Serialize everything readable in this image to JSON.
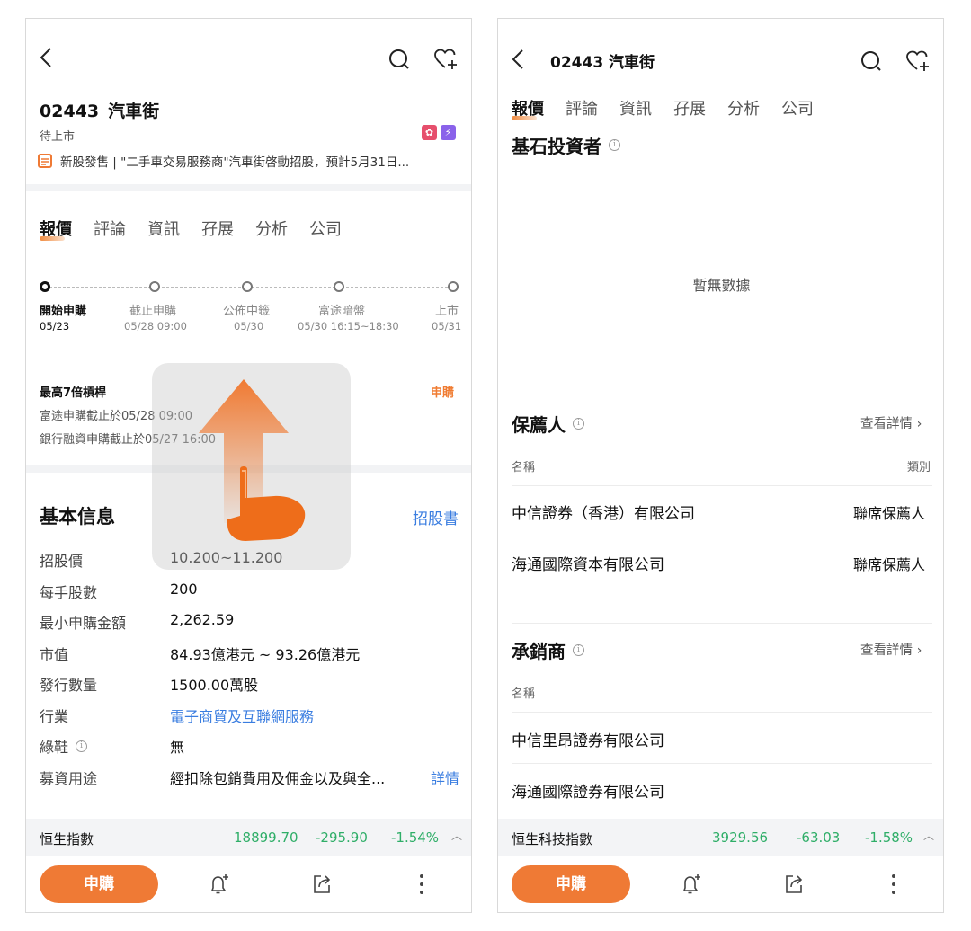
{
  "left": {
    "stock": {
      "code": "02443",
      "name": "汽車街",
      "status": "待上市"
    },
    "news": "新股發售 | \"二手車交易服務商\"汽車街啓動招股，預計5月31日...",
    "tabs": [
      "報價",
      "評論",
      "資訊",
      "孖展",
      "分析",
      "公司"
    ],
    "timeline": [
      {
        "label": "開始申購",
        "date": "05/23"
      },
      {
        "label": "截止申購",
        "date": "05/28 09:00"
      },
      {
        "label": "公佈中籤",
        "date": "05/30"
      },
      {
        "label": "富途暗盤",
        "date": "05/30 16:15~18:30"
      },
      {
        "label": "上市",
        "date": "05/31"
      }
    ],
    "leverage": "最高7倍槓桿",
    "subscribe_cta": "申購",
    "deadline_futu": "富途申購截止於05/28 09:00",
    "deadline_bank": "銀行融資申購截止於05/27 16:00",
    "basic_info": {
      "title": "基本信息",
      "prospectus": "招股書",
      "rows": [
        {
          "label": "招股價",
          "value": "10.200~11.200"
        },
        {
          "label": "每手股數",
          "value": "200"
        },
        {
          "label": "最小申購金額",
          "value": "2,262.59"
        },
        {
          "label": "市值",
          "value": "84.93億港元 ~ 93.26億港元"
        },
        {
          "label": "發行數量",
          "value": "1500.00萬股"
        },
        {
          "label": "行業",
          "value": "電子商貿及互聯網服務"
        },
        {
          "label": "綠鞋",
          "value": "無"
        },
        {
          "label": "募資用途",
          "value": "經扣除包銷費用及佣金以及與全..."
        }
      ],
      "detail_link": "詳情"
    },
    "index": {
      "name": "恒生指數",
      "value": "18899.70",
      "change": "-295.90",
      "pct": "-1.54%"
    },
    "subscribe_button": "申購"
  },
  "right": {
    "header_title": "02443 汽車街",
    "tabs": [
      "報價",
      "評論",
      "資訊",
      "孖展",
      "分析",
      "公司"
    ],
    "cornerstone": {
      "title": "基石投資者",
      "empty": "暫無數據"
    },
    "sponsors": {
      "title": "保薦人",
      "view_more": "查看詳情",
      "col_name": "名稱",
      "col_type": "類別",
      "rows": [
        {
          "name": "中信證券（香港）有限公司",
          "type": "聯席保薦人"
        },
        {
          "name": "海通國際資本有限公司",
          "type": "聯席保薦人"
        }
      ]
    },
    "underwriters": {
      "title": "承銷商",
      "view_more": "查看詳情",
      "col_name": "名稱",
      "rows": [
        {
          "name": "中信里昂證券有限公司"
        },
        {
          "name": "海通國際證券有限公司"
        }
      ]
    },
    "index": {
      "name": "恒生科技指數",
      "value": "3929.56",
      "change": "-63.03",
      "pct": "-1.58%"
    },
    "subscribe_button": "申購"
  },
  "colors": {
    "accent": "#ef7a35",
    "link": "#3a7de0",
    "down": "#2fae68"
  }
}
